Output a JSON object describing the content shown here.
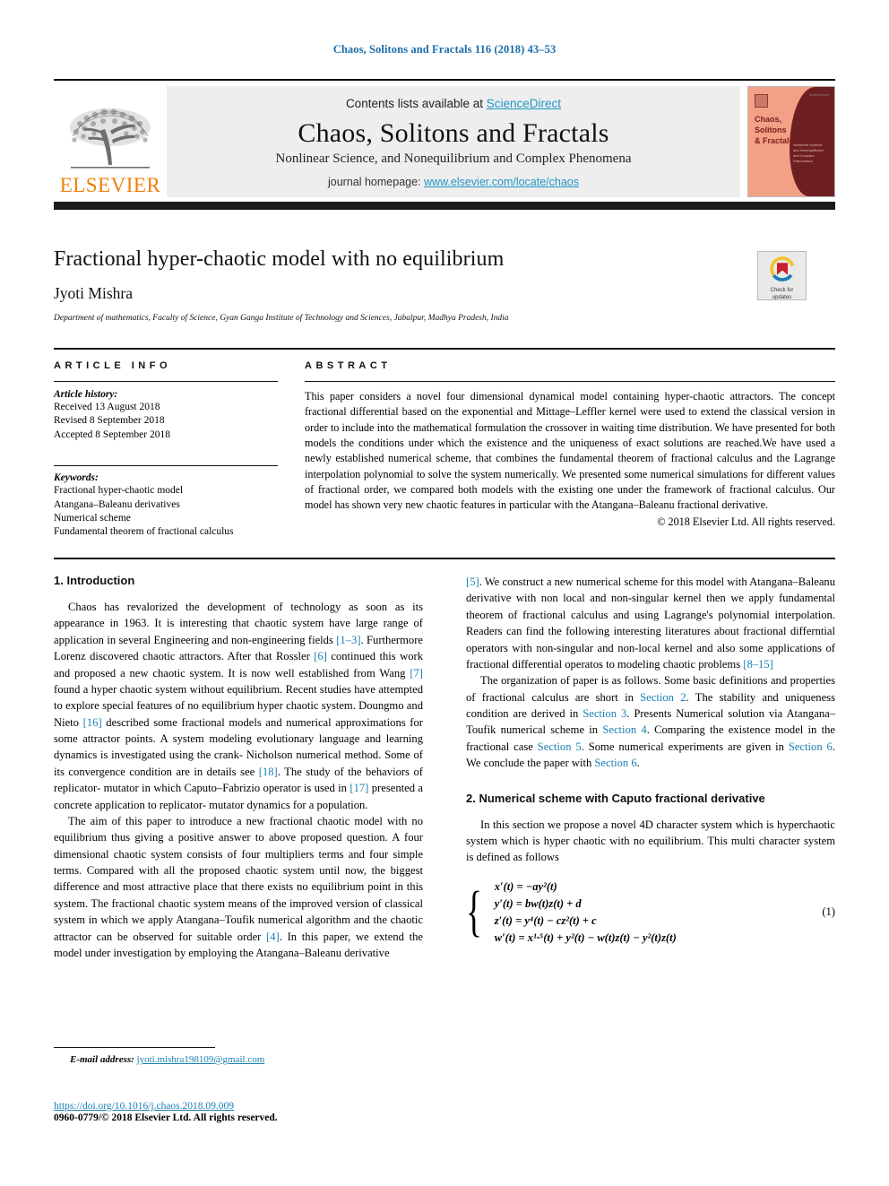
{
  "running_head": "Chaos, Solitons and Fractals 116 (2018) 43–53",
  "masthead": {
    "contents_prefix": "Contents lists available at ",
    "contents_link": "ScienceDirect",
    "journal_title": "Chaos, Solitons and Fractals",
    "journal_subtitle": "Nonlinear Science, and Nonequilibrium and Complex Phenomena",
    "homepage_prefix": "journal homepage: ",
    "homepage_link": "www.elsevier.com/locate/chaos",
    "publisher": "ELSEVIER",
    "cover": {
      "title_line1": "Chaos,",
      "title_line2": "Solitons",
      "title_line3": "& Fractals",
      "blurb": "Nonlinear Science and Nonequilibrium and Complex Phenomena",
      "corner_text": "ScienceDirect"
    }
  },
  "article": {
    "title": "Fractional hyper-chaotic model with no equilibrium",
    "authors": "Jyoti Mishra",
    "affiliation": "Department of mathematics, Faculty of Science, Gyan Ganga Institute of Technology and Sciences, Jabalpur, Madhya Pradesh, India",
    "crossmark": {
      "line1": "Check for",
      "line2": "updates"
    }
  },
  "article_info": {
    "heading": "ARTICLE INFO",
    "history_title": "Article history:",
    "history": [
      "Received 13 August 2018",
      "Revised 8 September 2018",
      "Accepted 8 September 2018"
    ],
    "keywords_title": "Keywords:",
    "keywords": [
      "Fractional hyper-chaotic model",
      "Atangana–Baleanu derivatives",
      "Numerical scheme",
      "Fundamental theorem of fractional calculus"
    ]
  },
  "abstract": {
    "heading": "ABSTRACT",
    "text": "This paper considers a novel four dimensional dynamical model containing hyper-chaotic attractors. The concept fractional differential based on the exponential and Mittage–Leffler kernel were used to extend the classical version in order to include into the mathematical formulation the crossover in waiting time distribution. We have presented for both models the conditions under which the existence and the uniqueness of exact solutions are reached.We have used a newly established numerical scheme, that combines the fundamental theorem of fractional calculus and the Lagrange interpolation polynomial to solve the system numerically. We presented some numerical simulations for different values of fractional order, we compared both models with the existing one under the framework of fractional calculus. Our model has shown very new chaotic features in particular with the Atangana–Baleanu fractional derivative.",
    "copyright": "© 2018 Elsevier Ltd. All rights reserved."
  },
  "body": {
    "section1_heading": "1. Introduction",
    "intro_p1_a": "Chaos has revalorized the development of technology as soon as its appearance in 1963. It is interesting that chaotic system have large range of application in several Engineering and non-engineering fields ",
    "intro_p1_ref1": "[1–3]",
    "intro_p1_b": ". Furthermore Lorenz discovered chaotic attractors. After that Rossler ",
    "intro_p1_ref2": "[6]",
    "intro_p1_c": " continued this work and proposed a new chaotic system. It is now well established from Wang ",
    "intro_p1_ref3": "[7]",
    "intro_p1_d": " found a hyper chaotic system without equilibrium. Recent studies have attempted to explore special features of no equilibrium hyper chaotic system. Doungmo and Nieto ",
    "intro_p1_ref4": "[16]",
    "intro_p1_e": " described some fractional models and numerical approximations for some attractor points. A system modeling evolutionary language and learning dynamics is investigated using the crank- Nicholson numerical method. Some of its convergence condition are in details see ",
    "intro_p1_ref5": "[18]",
    "intro_p1_f": ". The study of the behaviors of replicator- mutator in which Caputo–Fabrizio operator is used in ",
    "intro_p1_ref6": "[17]",
    "intro_p1_g": " presented a concrete application to replicator- mutator dynamics for a population.",
    "intro_p2_a": "The aim of this paper to introduce a new fractional chaotic model with no equilibrium thus giving a positive answer to above proposed question. A four dimensional chaotic system consists of four multipliers terms and four simple terms. Compared with all the proposed chaotic system until now, the biggest difference and most attractive place that there exists no equilibrium point in this system. The fractional chaotic system means of the improved version of classical system in which we apply Atangana–Toufik numerical algorithm and the chaotic attractor can be observed for suitable order ",
    "intro_p2_ref1": "[4]",
    "intro_p2_b": ". In this paper, we extend the model under investigation by employing the Atangana–Baleanu derivative ",
    "intro_p2_ref2": "[5]",
    "intro_p2_c": ". We construct a new numerical scheme for this model with Atangana–Baleanu derivative with non local and non-singular kernel then we apply fundamental theorem of fractional calculus and using Lagrange's polynomial interpolation. Readers can find the following interesting literatures about fractional differntial operators with non-singular and non-local kernel and also some applications of fractional differential operatos to modeling chaotic problems ",
    "intro_p2_ref3": "[8–15]",
    "org_p_a": "The organization of paper is as follows. Some basic definitions and properties of fractional calculus are short in ",
    "org_sec2": "Section 2",
    "org_p_b": ". The stability and uniqueness condition are derived in ",
    "org_sec3": "Section 3",
    "org_p_c": ". Presents Numerical solution via Atangana–Toufik numerical scheme in ",
    "org_sec4": "Section 4",
    "org_p_d": ". Comparing the existence model in the fractional case ",
    "org_sec5": "Section 5",
    "org_p_e": ". Some numerical experiments are given in ",
    "org_sec6": "Section 6",
    "org_p_f": ". We conclude the paper with ",
    "org_sec6b": "Section 6",
    "org_p_g": ".",
    "section2_heading": "2. Numerical scheme with Caputo fractional derivative",
    "sec2_p1": "In this section we propose a novel 4D character system which is hyperchaotic system which is hyper chaotic with no equilibrium. This multi character system is defined as follows",
    "equation": {
      "line1": "x′(t) = −ay²(t)",
      "line2": "y′(t) = bw(t)z(t) + d",
      "line3": "z′(t) = y⁴(t) − cz²(t) + c",
      "line4": "w′(t) = x¹·⁵(t) + y²(t) − w(t)z(t) − y²(t)z(t)",
      "number": "(1)"
    }
  },
  "footer": {
    "email_label": "E-mail address:",
    "email": "jyoti.mishra198109@gmail.com",
    "doi": "https://doi.org/10.1016/j.chaos.2018.09.009",
    "issn_line": "0960-0779/© 2018 Elsevier Ltd. All rights reserved."
  },
  "colors": {
    "link": "#1a7fb5",
    "masthead_link": "#2196c4",
    "elsevier_orange": "#f07f09",
    "header_blue": "#1a6ca8"
  }
}
